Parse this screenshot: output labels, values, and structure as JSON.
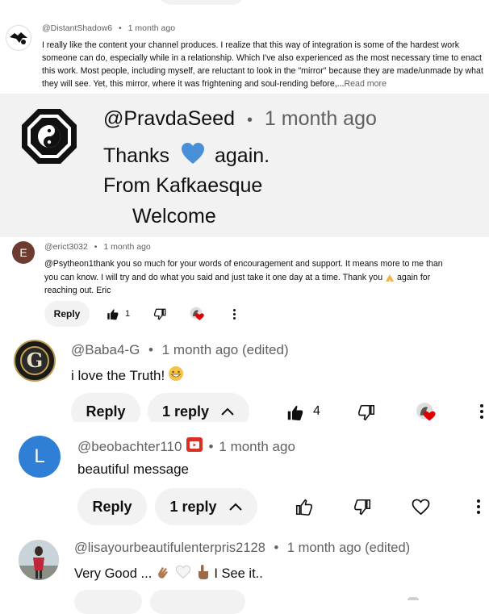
{
  "colors": {
    "accent_red": "#ff0000",
    "highlight_bg": "#f2f2f2",
    "meta_gray": "#606060",
    "avatar_e_bg": "#6d3b2f",
    "avatar_l_bg": "#2f7fd6"
  },
  "comments": [
    {
      "author": "@DistantShadow6",
      "sep": "•",
      "time": "1 month ago",
      "text": "I really like the content your channel produces. I realize that this way of integration is some of the hardest work someone can do, especially while in a relationship. Which I've also experienced as the most necessary time to enact this work. Most people, including myself, are reluctant to look in the \"mirror\" because they are made/unmade by what they will see. Yet, this mirror, where it was frightening and soul-rending before,...",
      "read_more": "Read more"
    },
    {
      "author": "@PravdaSeed",
      "sep": "•",
      "time": "1 month ago",
      "line1_a": "Thanks",
      "line1_b": "again.",
      "line2": "From Kafkaesque",
      "line3": "Welcome"
    },
    {
      "avatar_letter": "E",
      "author": "@erict3032",
      "sep": "•",
      "time": "1 month ago",
      "text_a": "@Psytheon1thank you so much for your words of encouragement and support. It means more to me than you can know. I will try and do what you said and just take it one day at a time. Thank you",
      "text_b": "again for reaching out. Eric",
      "reply_label": "Reply",
      "like_count": "1"
    },
    {
      "author": "@Baba4-G",
      "sep": "•",
      "time": "1 month ago (edited)",
      "text": "i love the Truth!",
      "reply_label": "Reply",
      "replies_label": "1 reply",
      "like_count": "4"
    },
    {
      "avatar_letter": "L",
      "author": "@beobachter110",
      "sep": "•",
      "time": "1 month ago",
      "text": "beautiful message",
      "reply_label": "Reply",
      "replies_label": "1 reply"
    },
    {
      "author": "@lisayourbeautifulenterpris2128",
      "sep": "•",
      "time": "1 month ago (edited)",
      "text_a": "Very Good ...",
      "text_b": "I See it.."
    }
  ]
}
